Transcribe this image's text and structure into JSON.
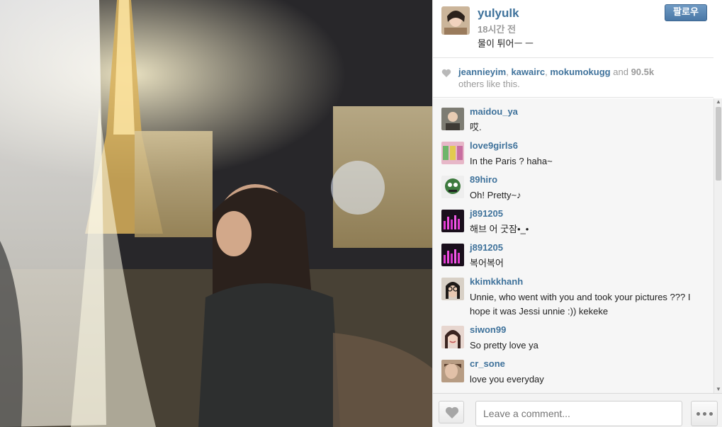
{
  "post": {
    "username": "yulyulk",
    "time": "18시간 전",
    "caption": "물이 튀어ㅡ ㅡ",
    "follow_label": "팔로우"
  },
  "likes": {
    "names": [
      "jeannieyim",
      "kawairc",
      "mokumokugg"
    ],
    "and_text": "and",
    "count": "90.5k",
    "suffix": "others like this."
  },
  "comments": [
    {
      "user": "maidou_ya",
      "text": "哎."
    },
    {
      "user": "love9girls6",
      "text": "In the Paris ? haha~"
    },
    {
      "user": "89hiro",
      "text": "Oh! Pretty~♪"
    },
    {
      "user": "j891205",
      "text": "해브 어 굿잠•_•"
    },
    {
      "user": "j891205",
      "text": "복어복어"
    },
    {
      "user": "kkimkkhanh",
      "text": "Unnie, who went with you and took your pictures ??? I hope it was Jessi unnie :)) kekeke"
    },
    {
      "user": "siwon99",
      "text": "So pretty love ya"
    },
    {
      "user": "cr_sone",
      "text": "love you everyday"
    }
  ],
  "footer": {
    "comment_placeholder": "Leave a comment..."
  },
  "icons": {
    "heart": "heart-icon",
    "more": "more-dots-icon",
    "scroll_up": "scroll-up-arrow-icon",
    "scroll_down": "scroll-down-arrow-icon"
  },
  "colors": {
    "username_blue": "#3f729b",
    "follow_button": "#4a78a6",
    "muted_text": "#9a9a9a",
    "comment_bg": "#f6f6f6"
  }
}
